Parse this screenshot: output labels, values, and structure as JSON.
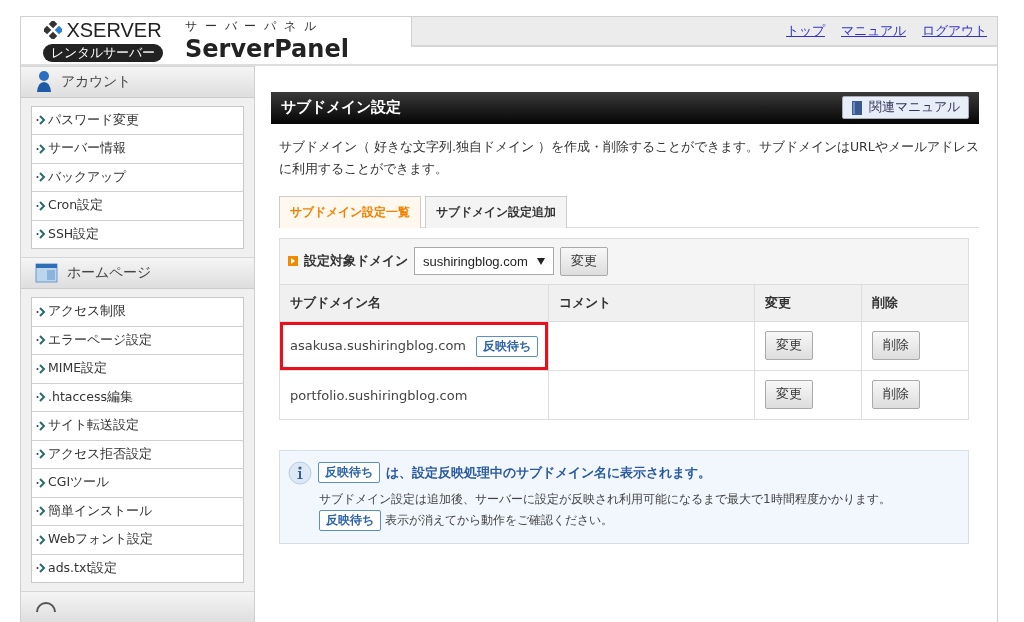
{
  "logo": {
    "brand": "XSERVER",
    "tagline": "レンタルサーバー",
    "subtitle": "サ ー バ ー パ ネ ル",
    "product": "ServerPanel"
  },
  "top_nav": [
    "トップ",
    "マニュアル",
    "ログアウト"
  ],
  "sidebar": {
    "sections": [
      {
        "kind": "account",
        "title": "アカウント",
        "items": [
          "パスワード変更",
          "サーバー情報",
          "バックアップ",
          "Cron設定",
          "SSH設定"
        ]
      },
      {
        "kind": "homepage",
        "title": "ホームページ",
        "items": [
          "アクセス制限",
          "エラーページ設定",
          "MIME設定",
          ".htaccess編集",
          "サイト転送設定",
          "アクセス拒否設定",
          "CGIツール",
          "簡単インストール",
          "Webフォント設定",
          "ads.txt設定"
        ]
      },
      {
        "kind": "more"
      }
    ]
  },
  "main": {
    "title": "サブドメイン設定",
    "manual_button": "関連マニュアル",
    "description": "サブドメイン（ 好きな文字列.独自ドメイン ）を作成・削除することができます。サブドメインはURLやメールアドレスに利用することができます。",
    "tabs": [
      {
        "label": "サブドメイン設定一覧",
        "selected": true
      },
      {
        "label": "サブドメイン設定追加",
        "selected": false
      }
    ],
    "domain_picker": {
      "label": "設定対象ドメイン",
      "value": "sushiringblog.com",
      "button": "変更"
    },
    "table": {
      "columns": [
        "サブドメイン名",
        "コメント",
        "変更",
        "削除"
      ],
      "rows": [
        {
          "name": "asakusa.sushiringblog.com",
          "badge": "反映待ち",
          "edit": "変更",
          "delete": "削除",
          "highlighted": true
        },
        {
          "name": "portfolio.sushiringblog.com",
          "edit": "変更",
          "delete": "削除",
          "highlighted": false
        }
      ]
    },
    "note": {
      "headline_badge": "反映待ち",
      "headline": "は、設定反映処理中のサブドメイン名に表示されます。",
      "body": "サブドメイン設定は追加後、サーバーに設定が反映され利用可能になるまで最大で1時間程度かかります。",
      "footer_badge": "反映待ち",
      "footer": "表示が消えてから動作をご確認ください。"
    }
  }
}
